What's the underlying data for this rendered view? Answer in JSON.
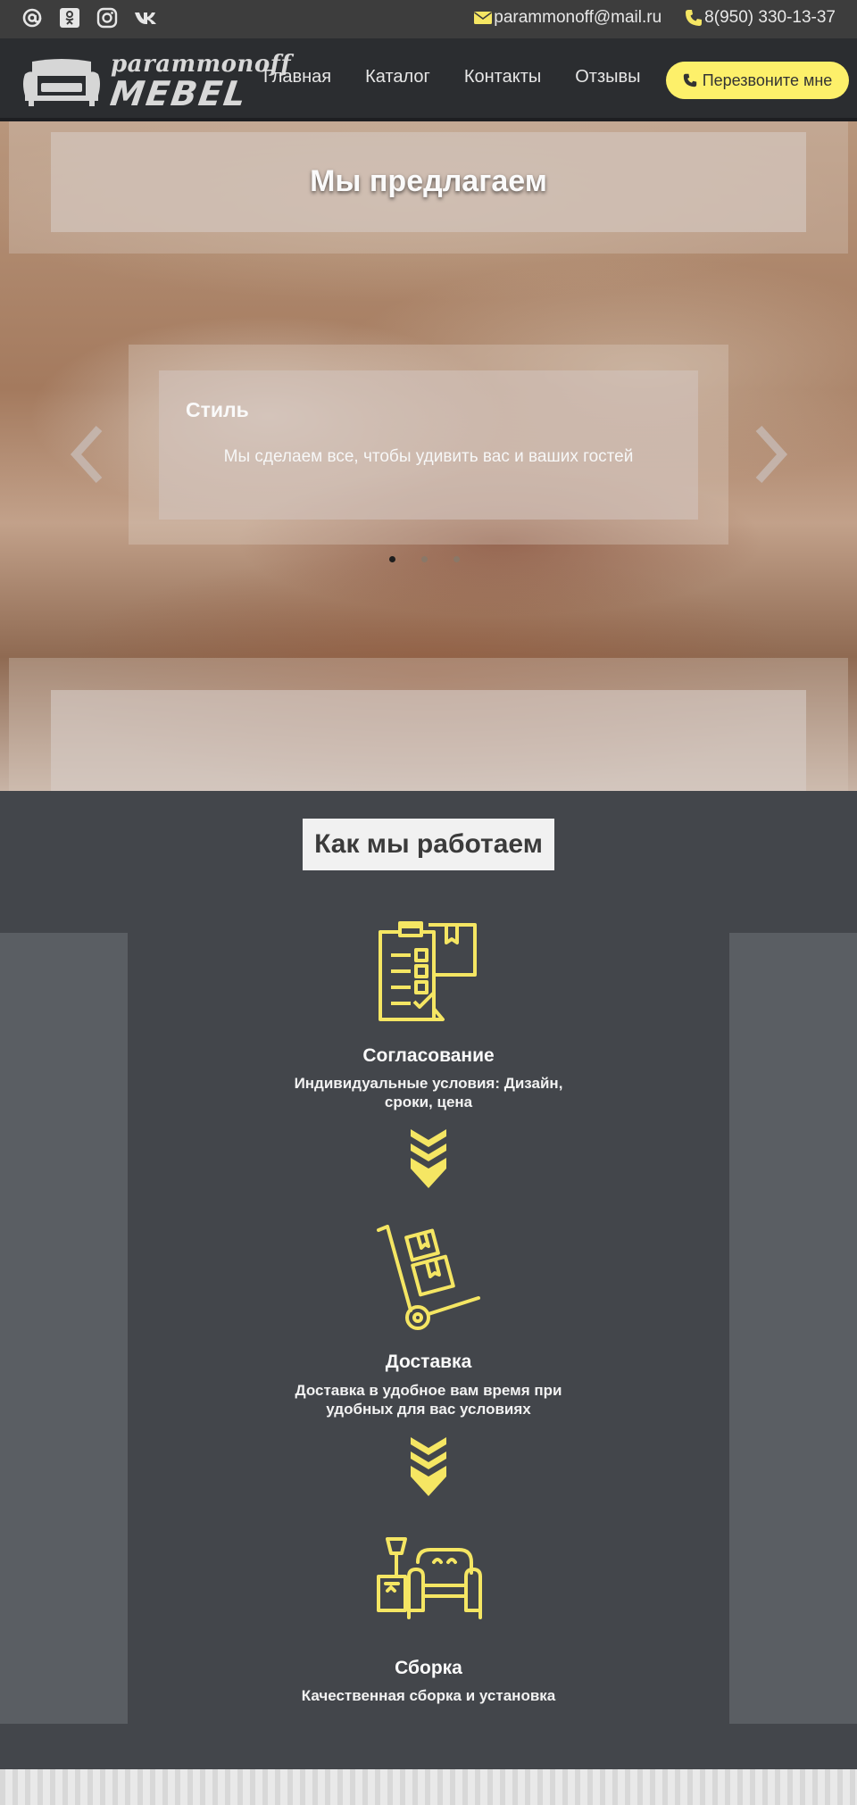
{
  "topbar": {
    "social": [
      "at-icon",
      "odnoklassniki-icon",
      "instagram-icon",
      "vk-icon"
    ],
    "email": "parammonoff@mail.ru",
    "phone": "8(950) 330-13-37"
  },
  "navbar": {
    "logo_line1": "parammonoff",
    "logo_line2": "MEBEL",
    "links": [
      "Главная",
      "Каталог",
      "Контакты",
      "Отзывы"
    ],
    "callback_label": "Перезвоните мне"
  },
  "hero": {
    "title": "Мы предлагаем",
    "slide": {
      "heading": "Стиль",
      "text": "Мы сделаем все, чтобы удивить вас и ваших гостей"
    },
    "dots_count": 3,
    "active_dot": 1
  },
  "work": {
    "title": "Как мы работаем",
    "steps": [
      {
        "title": "Согласование",
        "desc": "Индивидуальные условия: Дизайн, сроки, цена",
        "icon": "checklist-icon"
      },
      {
        "title": "Доставка",
        "desc": "Доставка в удобное вам время при удобных для вас условиях",
        "icon": "hand-truck-icon"
      },
      {
        "title": "Сборка",
        "desc": "Качественная сборка и установка",
        "icon": "furniture-icon"
      }
    ]
  },
  "colors": {
    "accent": "#fdf06a",
    "icon_yellow": "#f5e663",
    "topbar": "#3d3d3d",
    "navbar": "#2b2d30",
    "work_bg": "#43464b"
  }
}
